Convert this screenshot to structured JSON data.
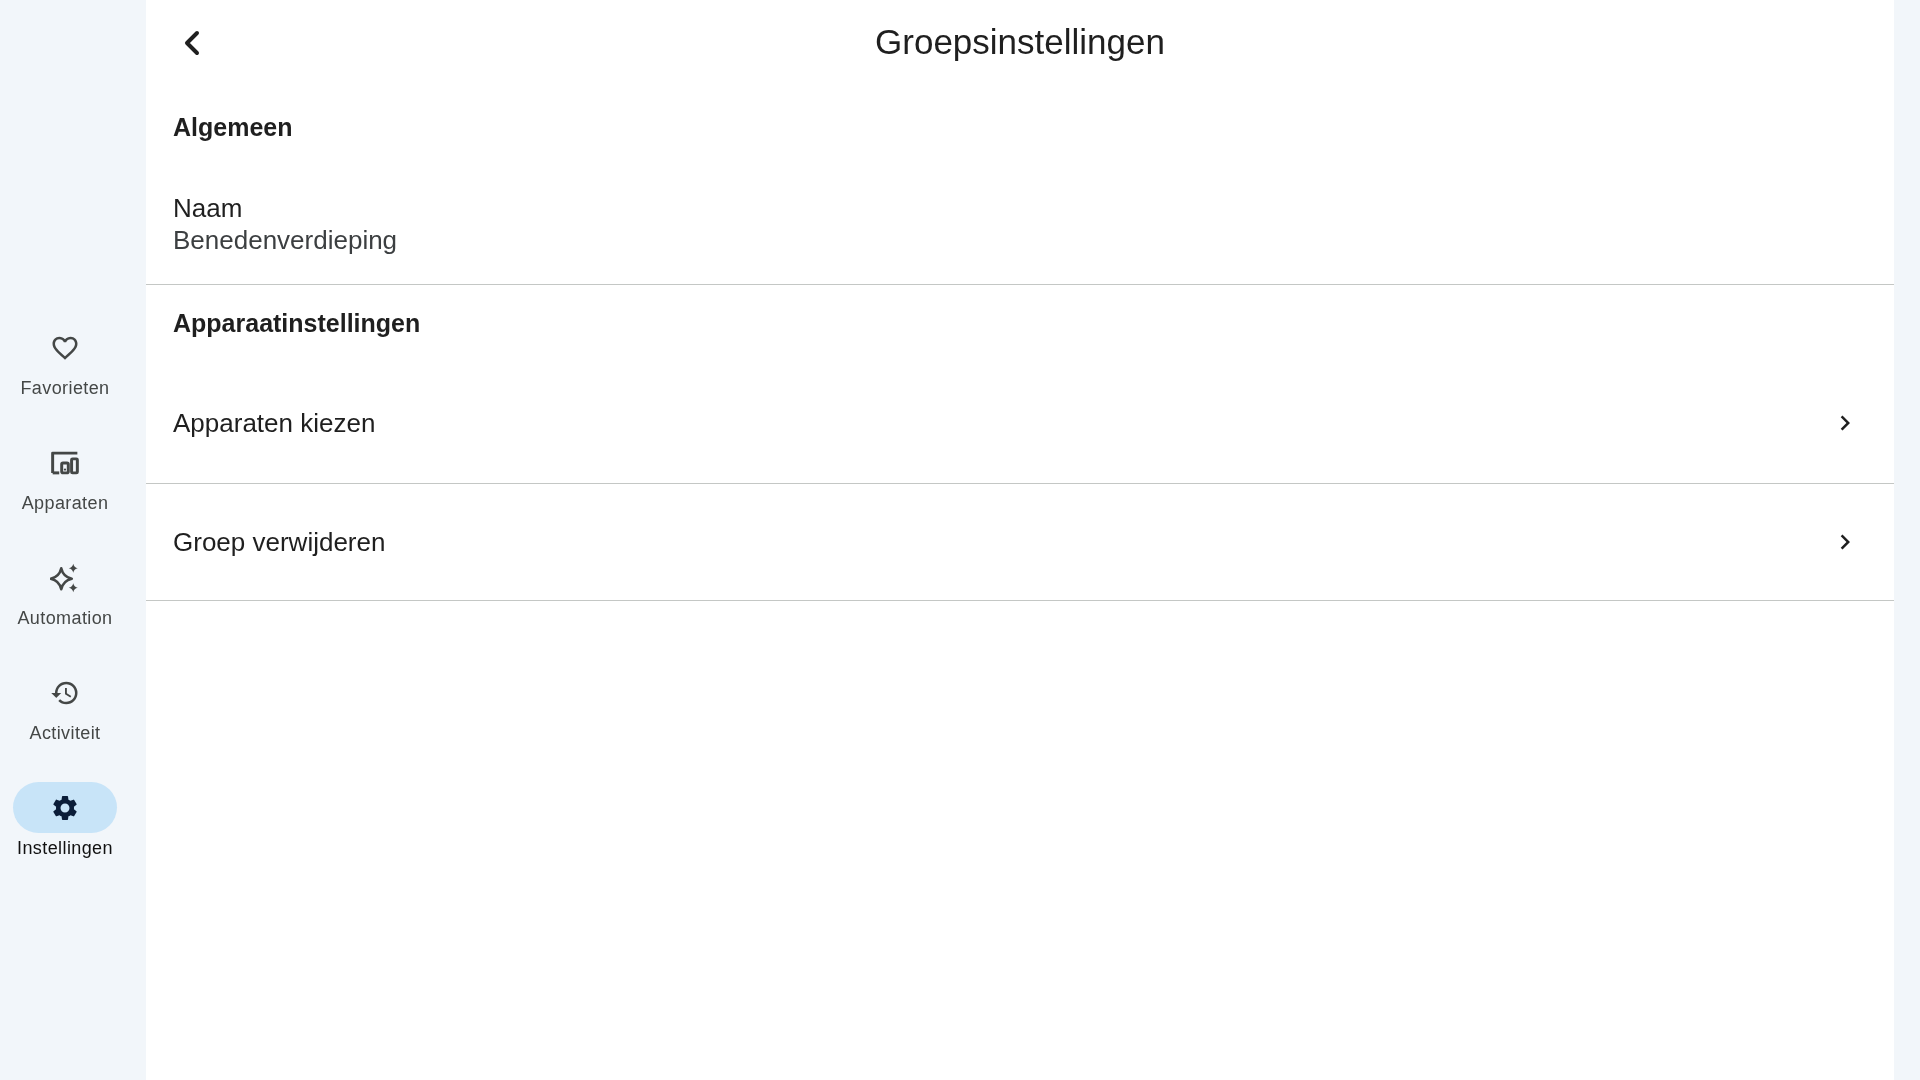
{
  "sidebar": {
    "items": [
      {
        "label": "Favorieten",
        "selected": false
      },
      {
        "label": "Apparaten",
        "selected": false
      },
      {
        "label": "Automation",
        "selected": false
      },
      {
        "label": "Activiteit",
        "selected": false
      },
      {
        "label": "Instellingen",
        "selected": true
      }
    ]
  },
  "header": {
    "title": "Groepsinstellingen"
  },
  "sections": [
    {
      "heading": "Algemeen",
      "rows": [
        {
          "kind": "field",
          "label": "Naam",
          "value": "Benedenverdieping"
        }
      ]
    },
    {
      "heading": "Apparaatinstellingen",
      "rows": [
        {
          "kind": "link",
          "label": "Apparaten kiezen"
        },
        {
          "kind": "link",
          "label": "Groep verwijderen"
        }
      ]
    }
  ]
}
